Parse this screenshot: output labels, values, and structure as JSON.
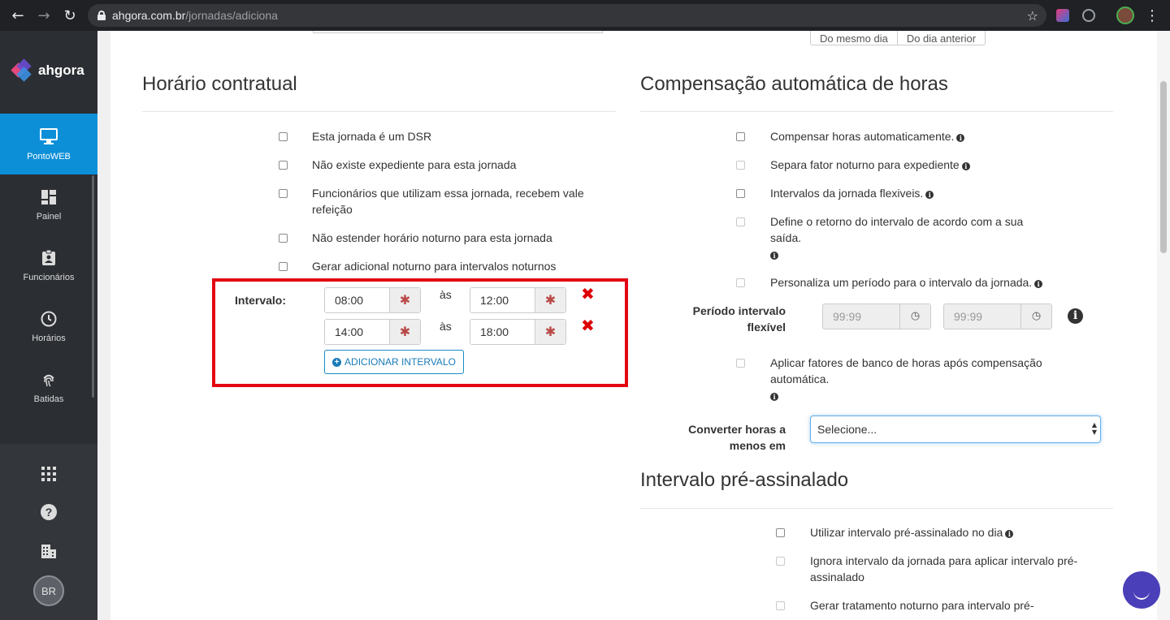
{
  "browser": {
    "url_host": "ahgora.com.br",
    "url_path": "/jornadas/adiciona"
  },
  "sidebar": {
    "logo": "ahgora",
    "items": [
      {
        "label": "PontoWEB",
        "icon": "monitor-icon",
        "active": true
      },
      {
        "label": "Painel",
        "icon": "dashboard-icon"
      },
      {
        "label": "Funcionários",
        "icon": "id-badge-icon"
      },
      {
        "label": "Horários",
        "icon": "clock-icon"
      },
      {
        "label": "Batidas",
        "icon": "fingerprint-icon"
      }
    ],
    "bottom_icons": [
      "apps-grid-icon",
      "help-icon",
      "building-icon"
    ],
    "avatar_initials": "BR"
  },
  "top_partial": {
    "buttons": [
      "Do mesmo dia",
      "Do dia anterior"
    ]
  },
  "horario_contratual": {
    "title": "Horário contratual",
    "options": [
      "Esta jornada é um DSR",
      "Não existe expediente para esta jornada",
      "Funcionários que utilizam essa jornada, recebem vale refeição",
      "Não estender horário noturno para esta jornada",
      "Gerar adicional noturno para intervalos noturnos"
    ],
    "intervalo_label": "Intervalo:",
    "separator": "às",
    "intervals": [
      {
        "start": "08:00",
        "end": "12:00"
      },
      {
        "start": "14:00",
        "end": "18:00"
      }
    ],
    "add_button": "ADICIONAR INTERVALO",
    "highlight_color": "#e30613"
  },
  "compensacao": {
    "title": "Compensação automática de horas",
    "options": [
      {
        "label": "Compensar horas automaticamente.",
        "info": true
      },
      {
        "label": "Separa fator noturno para expediente",
        "info": true
      },
      {
        "label": "Intervalos da jornada flexiveis.",
        "info": true
      },
      {
        "label": "Define o retorno do intervalo de acordo com a sua saída.",
        "info": true
      },
      {
        "label": "Personaliza um período para o intervalo da jornada.",
        "info": true
      }
    ],
    "periodo_label": "Período intervalo flexível",
    "periodo_placeholders": [
      "99:99",
      "99:99"
    ],
    "aplicar_label": "Aplicar fatores de banco de horas após compensação automática.",
    "converter_label": "Converter horas a menos em",
    "converter_value": "Selecione..."
  },
  "pre_assinalado": {
    "title": "Intervalo pré-assinalado",
    "options": [
      "Utilizar intervalo pré-assinalado no dia",
      "Ignora intervalo da jornada para aplicar intervalo pré-assinalado",
      "Gerar tratamento noturno para intervalo pré-"
    ]
  },
  "colors": {
    "accent": "#0d8fd8",
    "sidebar_bg": "#2b2e33",
    "remove": "#dd0000"
  }
}
